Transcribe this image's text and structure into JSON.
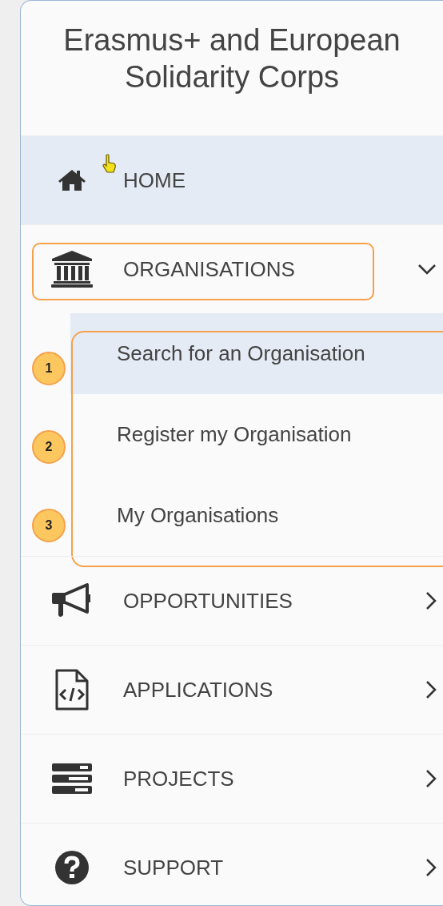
{
  "title": "Erasmus+ and European Solidarity Corps",
  "menu": [
    {
      "label": "HOME",
      "selected": true,
      "cursor": true
    },
    {
      "label": "ORGANISATIONS",
      "selected": false,
      "expanded": true,
      "highlighted": true,
      "submenu_highlighted": true,
      "children": [
        {
          "label": "Search for an Organisation",
          "selected": true,
          "callout": "1"
        },
        {
          "label": "Register my Organisation",
          "selected": false,
          "callout": "2"
        },
        {
          "label": "My Organisations",
          "selected": false,
          "callout": "3"
        }
      ]
    },
    {
      "label": "OPPORTUNITIES",
      "selected": false,
      "expanded": false
    },
    {
      "label": "APPLICATIONS",
      "selected": false,
      "expanded": false
    },
    {
      "label": "PROJECTS",
      "selected": false,
      "expanded": false
    },
    {
      "label": "SUPPORT",
      "selected": false,
      "expanded": false
    }
  ]
}
